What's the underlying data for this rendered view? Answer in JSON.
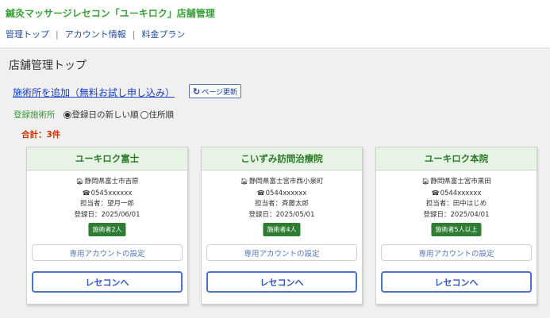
{
  "app": {
    "title": "鍼灸マッサージレセコン「ユーキロク」店舗管理"
  },
  "nav": {
    "items": [
      "管理トップ",
      "アカウント情報",
      "料金プラン"
    ],
    "separator": "|"
  },
  "page": {
    "title": "店舗管理トップ",
    "add_link": "施術所を追加（無料お試し申し込み）",
    "refresh_label": "ページ更新",
    "refresh_icon": "refresh-icon"
  },
  "sort": {
    "label": "登録施術所",
    "options": [
      "登録日の新しい順",
      "住所順"
    ],
    "selected": "登録日の新しい順"
  },
  "total": "合計：3件",
  "cards": [
    {
      "name": "ユーキロク富士",
      "address": "静岡県富士市吉原",
      "phone": "0545xxxxxx",
      "manager": "担当者：望月一郎",
      "registered": "登録日：2025/06/01",
      "badge": "施術者2人",
      "account_button": "専用アカウントの設定",
      "rececon_button": "レセコンへ"
    },
    {
      "name": "こいずみ訪問治療院",
      "address": "静岡県富士宮市西小泉町",
      "phone": "0544xxxxxx",
      "manager": "担当者：斉藤太郎",
      "registered": "登録日：2025/05/01",
      "badge": "施術者4人",
      "account_button": "専用アカウントの設定",
      "rececon_button": "レセコンへ"
    },
    {
      "name": "ユーキロク本院",
      "address": "静岡県富士宮市黒田",
      "phone": "0544xxxxxx",
      "manager": "担当者：田中はじめ",
      "registered": "登録日：2025/04/01",
      "badge": "施術者5人以上",
      "account_button": "専用アカウントの設定",
      "rececon_button": "レセコンへ"
    }
  ],
  "icons": {
    "address": "home-icon",
    "phone": "phone-icon"
  },
  "colors": {
    "brand_green": "#3aa03a",
    "badge_green": "#2e7d32",
    "total_red": "#cc3300",
    "link_blue": "#1a40c0"
  }
}
